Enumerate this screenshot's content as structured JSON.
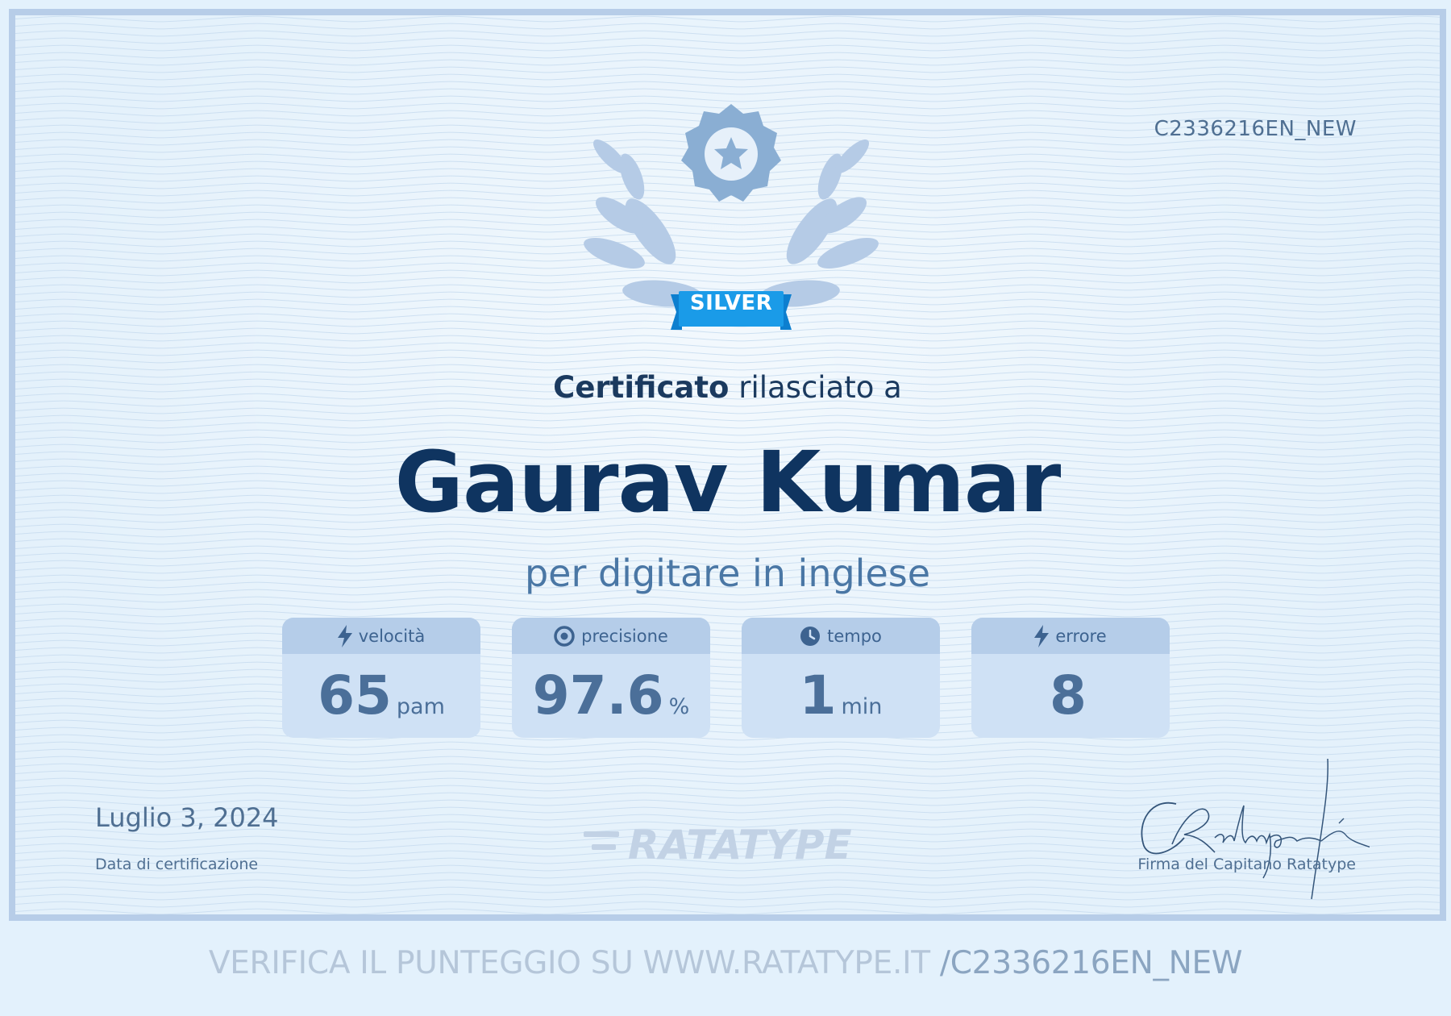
{
  "certificate": {
    "id": "C2336216EN_NEW",
    "level_badge": "SILVER",
    "heading_bold": "Certificato",
    "heading_rest": " rilasciato a",
    "recipient_name": "Gaurav Kumar",
    "subtitle": "per digitare in inglese"
  },
  "stats": [
    {
      "icon": "lightning-icon",
      "label": "velocità",
      "value": "65",
      "unit": "pam"
    },
    {
      "icon": "target-icon",
      "label": "precisione",
      "value": "97.6",
      "unit": "%"
    },
    {
      "icon": "clock-icon",
      "label": "tempo",
      "value": "1",
      "unit": "min"
    },
    {
      "icon": "lightning-icon",
      "label": "errore",
      "value": "8",
      "unit": ""
    }
  ],
  "footer": {
    "date": "Luglio 3, 2024",
    "date_label": "Data di certificazione",
    "brand": "RATATYPE",
    "signature_label": "Firma del Capitano Ratatype",
    "signature_text": "CRatatypeFé"
  },
  "verify": {
    "prefix": "VERIFICA IL PUNTEGGIO SU WWW.RATATYPE.IT ",
    "path": "/C2336216EN_NEW"
  },
  "colors": {
    "border": "#b7cde8",
    "name": "#0f3460",
    "accent_ribbon": "#1a9be8",
    "badge_star": "#8aaed3"
  }
}
